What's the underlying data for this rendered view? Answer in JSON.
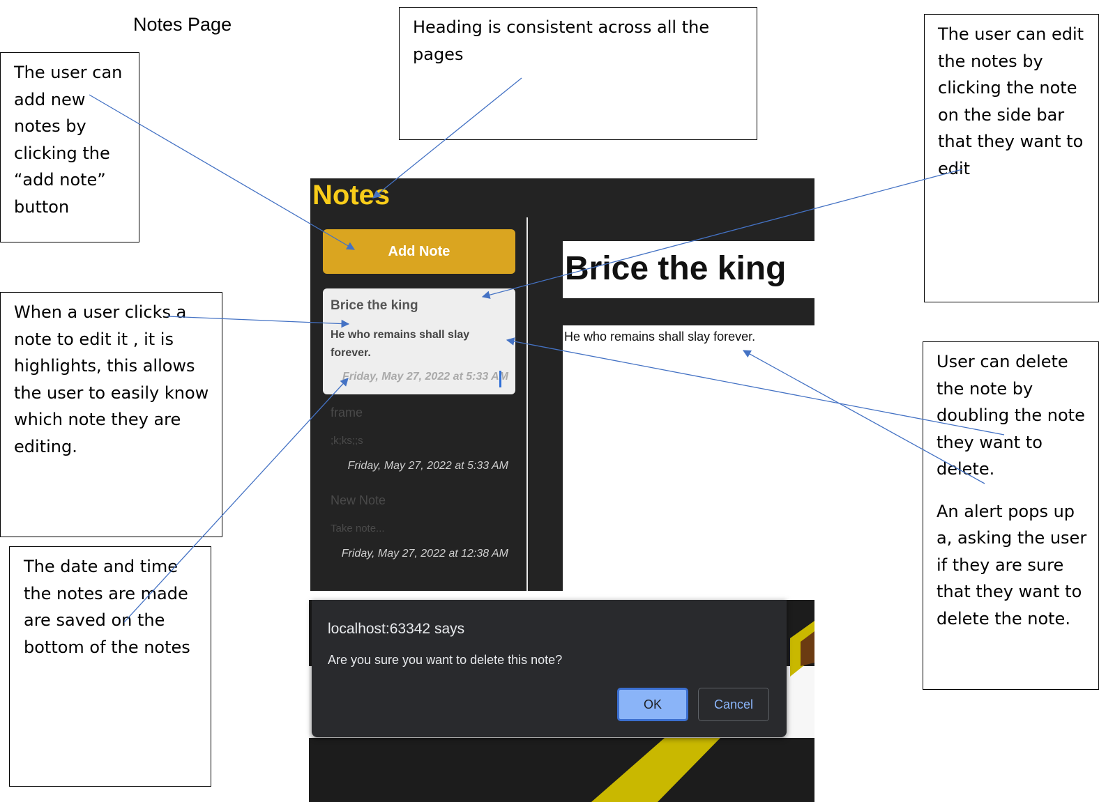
{
  "page_label": "Notes Page",
  "callouts": {
    "heading": [
      "Heading is consistent across all the",
      "pages"
    ],
    "add_note": [
      "The user can",
      "add new",
      "notes by",
      "clicking the",
      "“add  note”",
      "button"
    ],
    "edit": [
      "The user can edit",
      "the notes by",
      "clicking the note",
      "on the side bar",
      "that they want to",
      "edit"
    ],
    "highlight": [
      "When a user clicks a",
      "note to edit it , it is",
      "highlights, this allows",
      "the user to easily know",
      "which note they are",
      "editing."
    ],
    "delete": [
      "User can delete",
      "the note by",
      "doubling the note",
      "they want to",
      "delete."
    ],
    "alert": [
      "An alert pops up",
      "a, asking the user",
      "if they are sure",
      "that they want to",
      "delete the note."
    ],
    "date": [
      "The date and time",
      "the notes are made",
      "are saved on the",
      "bottom of the notes"
    ]
  },
  "app": {
    "title": "Notes",
    "add_note_label": "Add Note",
    "notes": [
      {
        "title": "Brice the king",
        "body": "He who remains shall slay forever.",
        "date": "Friday, May 27, 2022 at 5:33 AM"
      },
      {
        "title": "frame",
        "body": ";k;ks;;s",
        "date": "Friday, May 27, 2022 at 5:33 AM"
      },
      {
        "title": "New Note",
        "body": "Take note...",
        "date": "Friday, May 27, 2022 at 12:38 AM"
      }
    ],
    "editor_title": "Brice the king",
    "editor_body": "He who remains shall slay forever."
  },
  "alert": {
    "title": "localhost:63342 says",
    "message": "Are you sure you want to delete this note?",
    "ok_label": "OK",
    "cancel_label": "Cancel"
  },
  "colors": {
    "accent": "#daa520",
    "heading": "#f9cd1a",
    "dark_bg": "#232323",
    "arrow": "#4472c4"
  }
}
